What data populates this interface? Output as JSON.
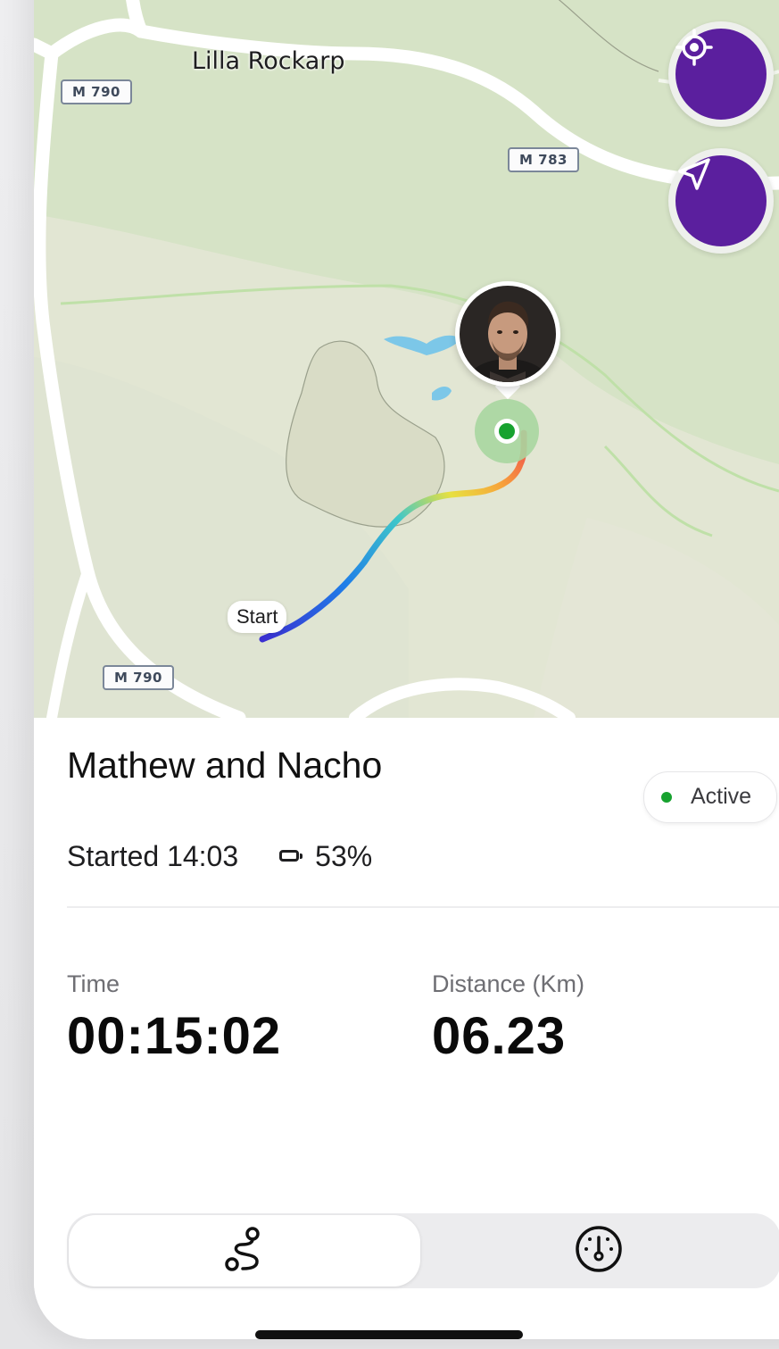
{
  "map": {
    "place_label": "Lilla Rockarp",
    "road_shields": [
      "M 790",
      "M 783",
      "M 790"
    ],
    "start_label": "Start",
    "recenter_button_icon": "crosshair-target-icon",
    "navigate_button_icon": "navigation-arrow-icon",
    "marker_avatar": "user-avatar-photo"
  },
  "session": {
    "title": "Mathew and Nacho",
    "status": "Active",
    "status_color": "#17a22f",
    "started": "Started 14:03",
    "battery": "53%",
    "battery_icon": "battery-icon"
  },
  "stats": {
    "time_label": "Time",
    "time_value": "00:15:02",
    "distance_label": "Distance (Km)",
    "distance_value": "06.23"
  },
  "tabs": [
    {
      "icon": "route-icon",
      "active": true
    },
    {
      "icon": "speedometer-icon",
      "active": false
    }
  ],
  "colors": {
    "accent": "#5b1f9e",
    "status_active": "#17a22f",
    "map_background": "#dfe6d1"
  }
}
